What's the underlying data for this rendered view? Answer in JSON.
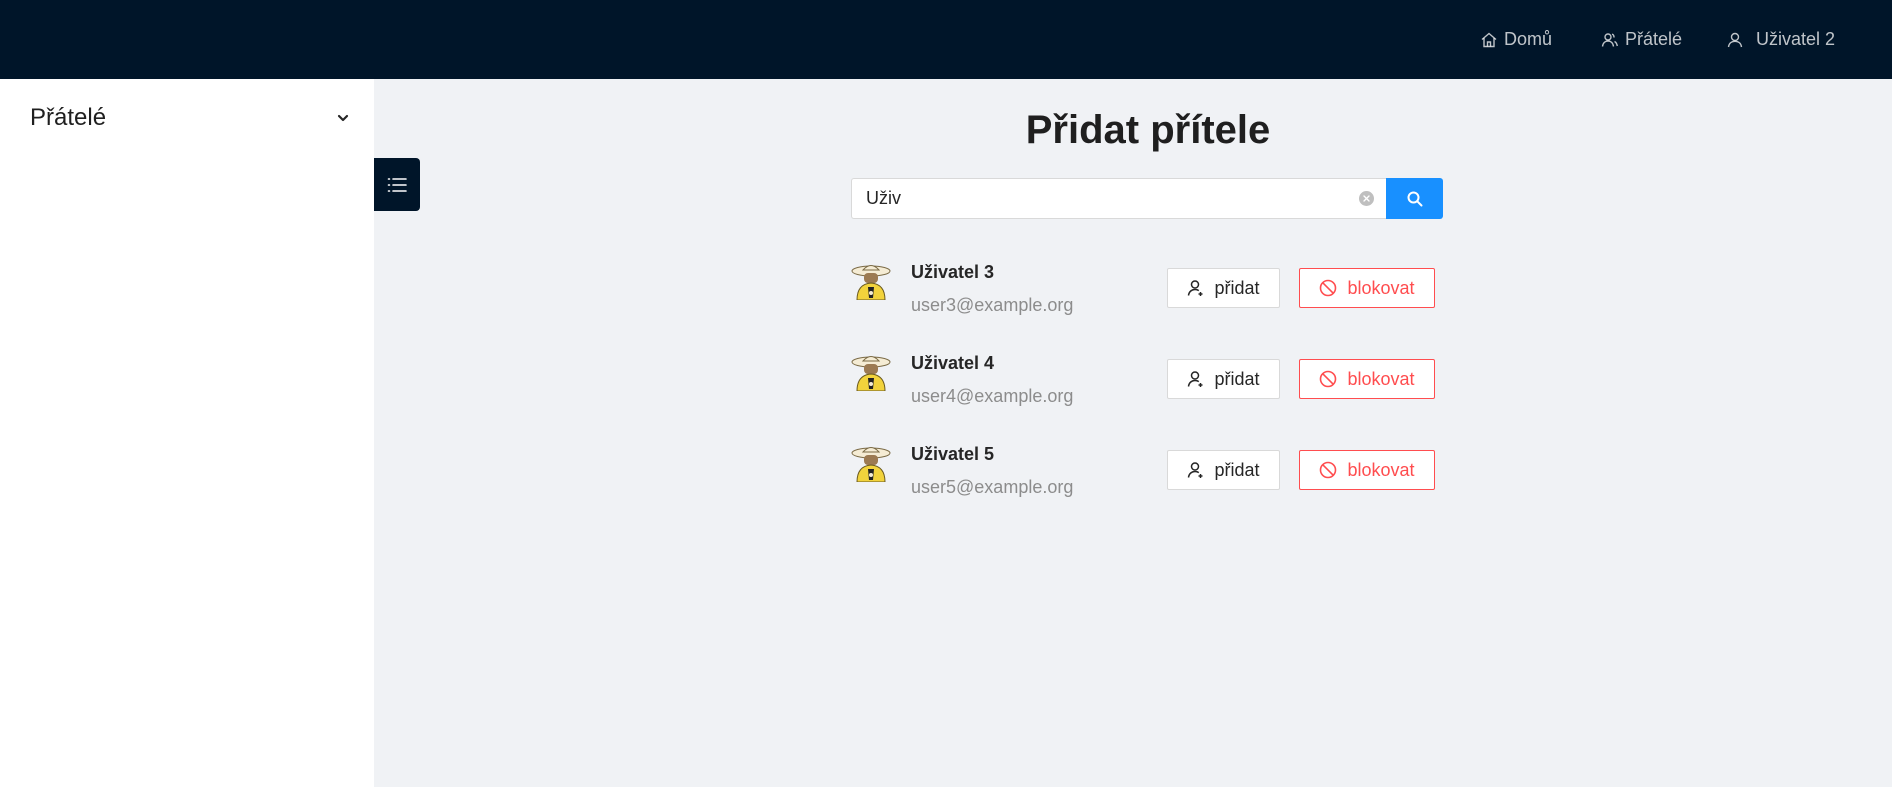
{
  "header": {
    "nav": [
      {
        "label": "Domů",
        "icon": "home-icon"
      },
      {
        "label": "Přátelé",
        "icon": "friends-icon"
      },
      {
        "label": "Uživatel 2",
        "icon": "user-icon"
      }
    ]
  },
  "sidebar": {
    "title": "Přátelé",
    "toggle_icon": "list-icon"
  },
  "main": {
    "title": "Přidat přítele",
    "search": {
      "value": "Uživ",
      "placeholder": ""
    },
    "users": [
      {
        "name": "Uživatel 3",
        "email": "user3@example.org",
        "add_label": "přidat",
        "block_label": "blokovat"
      },
      {
        "name": "Uživatel 4",
        "email": "user4@example.org",
        "add_label": "přidat",
        "block_label": "blokovat"
      },
      {
        "name": "Uživatel 5",
        "email": "user5@example.org",
        "add_label": "přidat",
        "block_label": "blokovat"
      }
    ]
  },
  "colors": {
    "header_bg": "#001529",
    "primary": "#1890ff",
    "danger": "#ff4d4f",
    "content_bg": "#f0f2f5"
  }
}
